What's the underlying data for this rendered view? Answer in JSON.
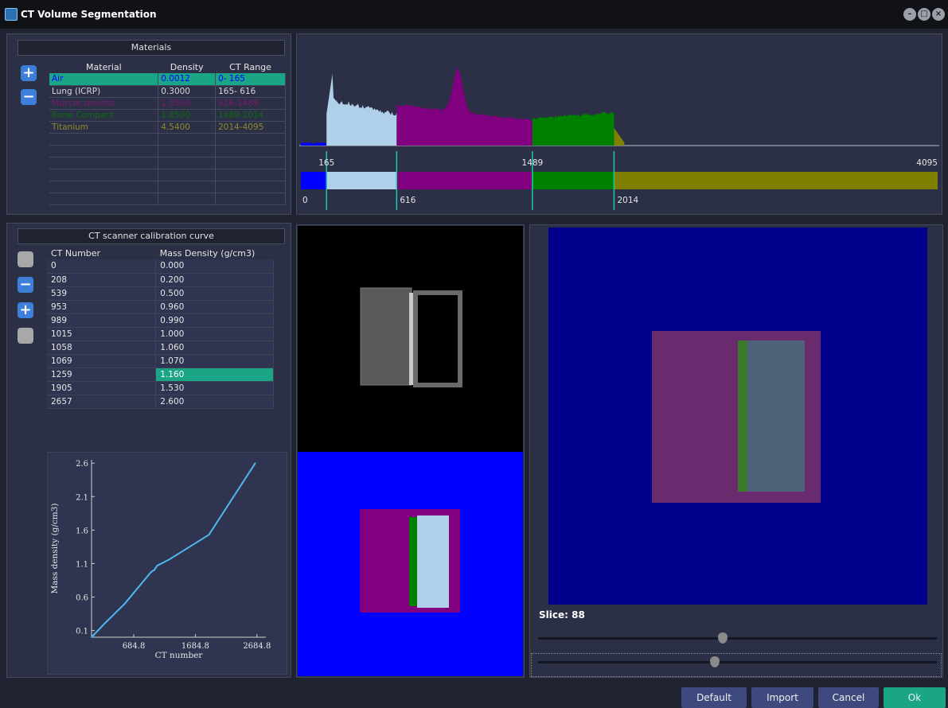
{
  "window": {
    "title": "CT Volume Segmentation"
  },
  "materials": {
    "header": "Materials",
    "columns": [
      "Material",
      "Density",
      "CT Range"
    ],
    "rows": [
      {
        "name": "Air",
        "density": "0.0012",
        "range": "0- 165",
        "color": "#0000ff",
        "selected": true
      },
      {
        "name": "Lung (ICRP)",
        "density": "0.3000",
        "range": "165- 616",
        "color": "#d8d8d8"
      },
      {
        "name": "Muscle skeletal",
        "density": "1.0500",
        "range": "616-1489",
        "color": "#7a1a6e"
      },
      {
        "name": "Bone Compact",
        "density": "1.8500",
        "range": "1489-2014",
        "color": "#0d6b0d"
      },
      {
        "name": "Titanium",
        "density": "4.5400",
        "range": "2014-4095",
        "color": "#8c8a2b"
      }
    ]
  },
  "histogram": {
    "top_labels": [
      "165",
      "1489",
      "4095"
    ],
    "bottom_labels": [
      "0",
      "616",
      "2014"
    ],
    "segment_colors": {
      "air": "#0000ff",
      "lung": "#b0cfe8",
      "muscle": "#800080",
      "bone": "#008000",
      "titanium": "#808000"
    }
  },
  "calibration": {
    "header": "CT scanner calibration curve",
    "columns": [
      "CT Number",
      "Mass Density (g/cm3)"
    ],
    "rows": [
      {
        "ct": "0",
        "density": "0.000"
      },
      {
        "ct": "208",
        "density": "0.200"
      },
      {
        "ct": "539",
        "density": "0.500"
      },
      {
        "ct": "953",
        "density": "0.960"
      },
      {
        "ct": "989",
        "density": "0.990"
      },
      {
        "ct": "1015",
        "density": "1.000"
      },
      {
        "ct": "1058",
        "density": "1.060"
      },
      {
        "ct": "1069",
        "density": "1.070"
      },
      {
        "ct": "1259",
        "density": "1.160",
        "selected": true
      },
      {
        "ct": "1905",
        "density": "1.530"
      },
      {
        "ct": "2657",
        "density": "2.600"
      }
    ]
  },
  "chart_data": {
    "type": "line",
    "x": [
      0,
      208,
      539,
      953,
      989,
      1015,
      1058,
      1069,
      1259,
      1905,
      2657
    ],
    "y": [
      0.0,
      0.2,
      0.5,
      0.96,
      0.99,
      1.0,
      1.06,
      1.07,
      1.16,
      1.53,
      2.6
    ],
    "xlabel": "CT number",
    "ylabel": "Mass density (g/cm3)",
    "xticks": [
      "684.8",
      "1684.8",
      "2684.8"
    ],
    "yticks": [
      "0.1",
      "0.6",
      "1.1",
      "1.6",
      "2.1",
      "2.6"
    ],
    "xlim": [
      0,
      2700
    ],
    "ylim": [
      0,
      2.65
    ]
  },
  "slice": {
    "label": "Slice: 88"
  },
  "buttons": {
    "default": "Default",
    "import": "Import",
    "cancel": "Cancel",
    "ok": "Ok"
  }
}
